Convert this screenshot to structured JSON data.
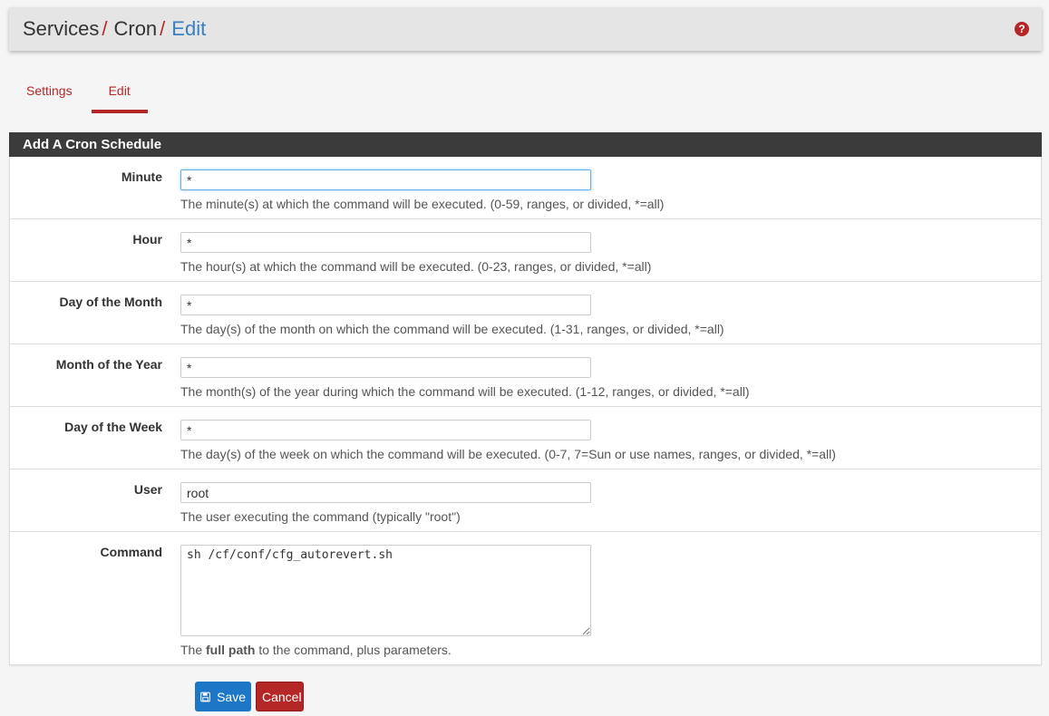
{
  "breadcrumb": {
    "items": [
      "Services",
      "Cron",
      "Edit"
    ],
    "separator": "/"
  },
  "help_icon": "question-icon",
  "tabs": [
    {
      "label": "Settings",
      "active": false
    },
    {
      "label": "Edit",
      "active": true
    }
  ],
  "panel": {
    "title": "Add A Cron Schedule",
    "fields": [
      {
        "label": "Minute",
        "value": "*",
        "help": "The minute(s) at which the command will be executed. (0-59, ranges, or divided, *=all)"
      },
      {
        "label": "Hour",
        "value": "*",
        "help": "The hour(s) at which the command will be executed. (0-23, ranges, or divided, *=all)"
      },
      {
        "label": "Day of the Month",
        "value": "*",
        "help": "The day(s) of the month on which the command will be executed. (1-31, ranges, or divided, *=all)"
      },
      {
        "label": "Month of the Year",
        "value": "*",
        "help": "The month(s) of the year during which the command will be executed. (1-12, ranges, or divided, *=all)"
      },
      {
        "label": "Day of the Week",
        "value": "*",
        "help": "The day(s) of the week on which the command will be executed. (0-7, 7=Sun or use names, ranges, or divided, *=all)"
      },
      {
        "label": "User",
        "value": "root",
        "help": "The user executing the command (typically \"root\")"
      }
    ],
    "command": {
      "label": "Command",
      "value": "sh /cf/conf/cfg_autorevert.sh",
      "help_prefix": "The ",
      "help_bold": "full path",
      "help_suffix": " to the command, plus parameters."
    }
  },
  "buttons": {
    "save_label": "Save",
    "cancel_label": "Cancel",
    "save_icon": "floppy-disk-icon"
  },
  "colors": {
    "accent_red": "#b52727",
    "link_blue": "#3a7fc1",
    "save_blue": "#1e76c6",
    "panel_header": "#3b3b3b"
  }
}
